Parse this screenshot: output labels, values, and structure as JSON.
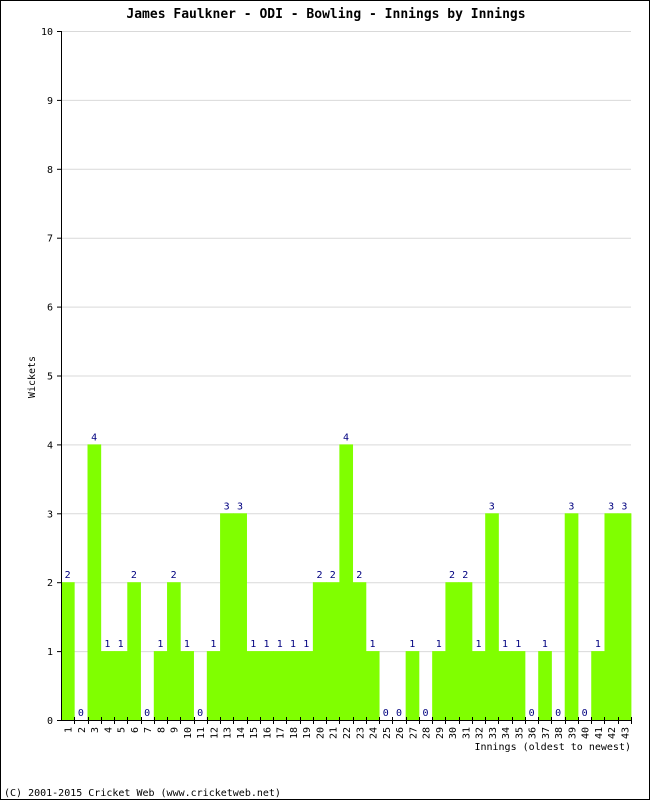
{
  "chart_data": {
    "type": "bar",
    "title": "James Faulkner - ODI - Bowling - Innings by Innings",
    "xlabel": "Innings (oldest to newest)",
    "ylabel": "Wickets",
    "ylim": [
      0,
      10
    ],
    "yticks": [
      0,
      1,
      2,
      3,
      4,
      5,
      6,
      7,
      8,
      9,
      10
    ],
    "grid": true,
    "legend": "none",
    "categories": [
      "1",
      "2",
      "3",
      "4",
      "5",
      "6",
      "7",
      "8",
      "9",
      "10",
      "11",
      "12",
      "13",
      "14",
      "15",
      "16",
      "17",
      "18",
      "19",
      "20",
      "21",
      "22",
      "23",
      "24",
      "25",
      "26",
      "27",
      "28",
      "29",
      "30",
      "31",
      "32",
      "33",
      "34",
      "35",
      "36",
      "37",
      "38",
      "39",
      "40",
      "41",
      "42",
      "43"
    ],
    "values": [
      2,
      0,
      4,
      1,
      1,
      2,
      0,
      1,
      2,
      1,
      0,
      1,
      3,
      3,
      1,
      1,
      1,
      1,
      1,
      2,
      2,
      4,
      2,
      1,
      0,
      0,
      1,
      0,
      1,
      2,
      2,
      1,
      3,
      1,
      1,
      0,
      1,
      0,
      3,
      0,
      1,
      3,
      3
    ],
    "colors": {
      "bar": "#80ff00",
      "value_label": "#000080",
      "grid": "#d9d9d9",
      "axis": "#000000"
    }
  },
  "footer": "(C) 2001-2015 Cricket Web (www.cricketweb.net)"
}
